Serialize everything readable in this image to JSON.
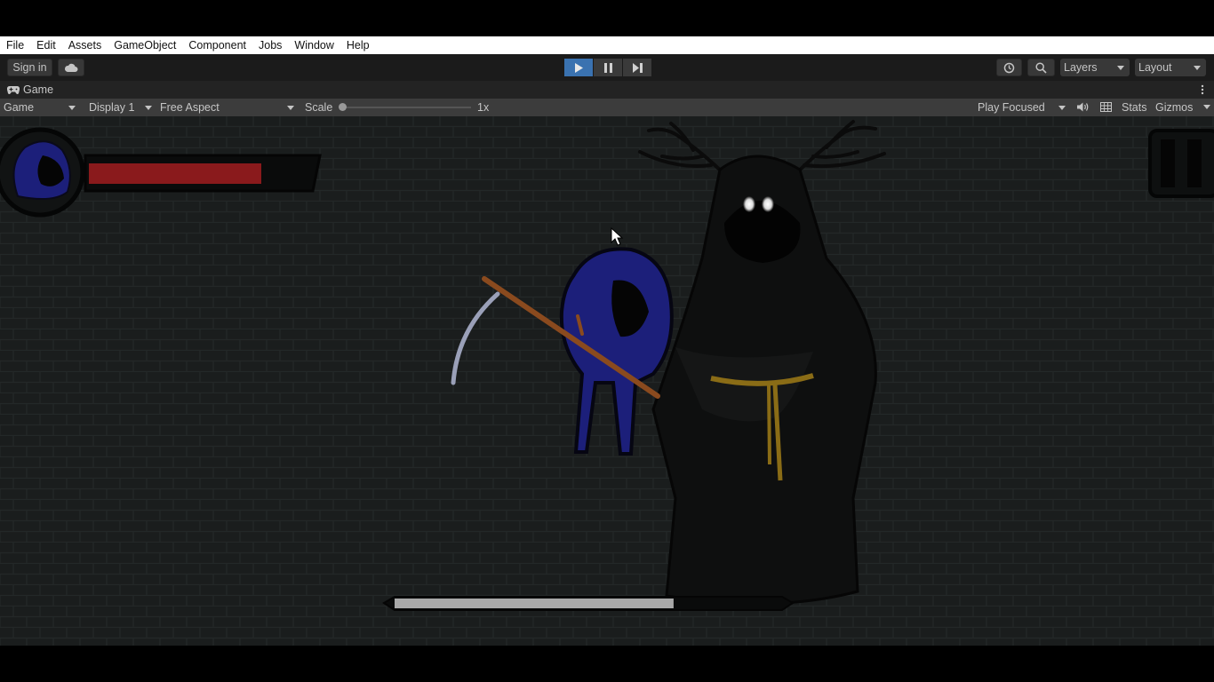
{
  "menu": {
    "items": [
      "File",
      "Edit",
      "Assets",
      "GameObject",
      "Component",
      "Jobs",
      "Window",
      "Help"
    ]
  },
  "toolbar": {
    "sign_in": "Sign in",
    "layers": "Layers",
    "layout": "Layout"
  },
  "tab": {
    "title": "Game"
  },
  "controls": {
    "mode": "Game",
    "display": "Display 1",
    "aspect": "Free Aspect",
    "scale_label": "Scale",
    "scale_value": "1x",
    "play_mode": "Play Focused",
    "stats": "Stats",
    "gizmos": "Gizmos"
  },
  "game": {
    "player_health_fraction": 0.77,
    "boss_health_fraction": 0.72
  },
  "colors": {
    "play_active": "#3a72b0",
    "health_red": "#8a1a1c",
    "boss_bar": "#a8a8a8",
    "player_blue": "#1c1f7a",
    "background_wall": "#1a1d1d"
  }
}
